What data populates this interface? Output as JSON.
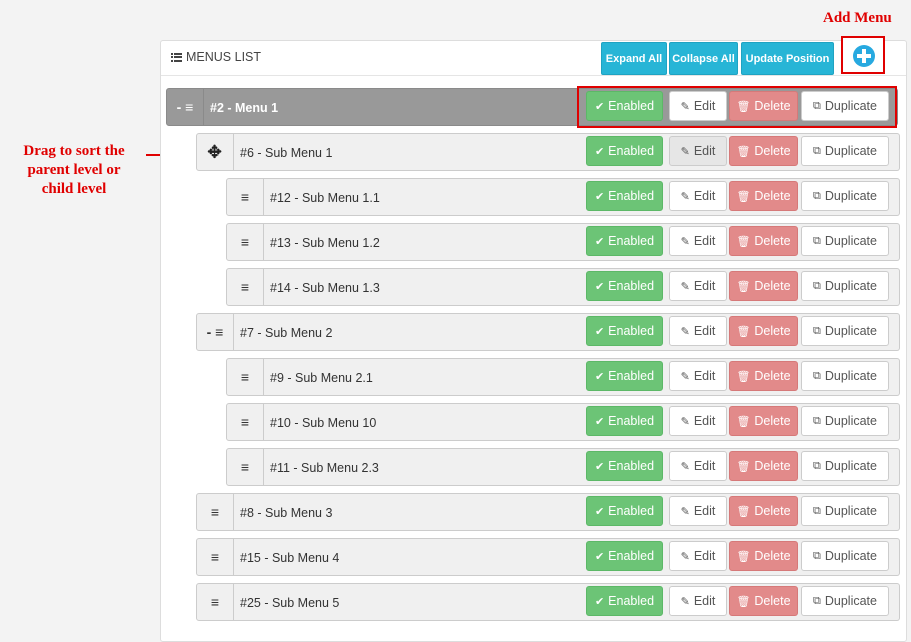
{
  "annotations": {
    "add_menu": "Add Menu",
    "drag_note": "Drag to sort the parent level or child level"
  },
  "panel": {
    "title": "MENUS LIST",
    "buttons": {
      "expand_all": "Expand All",
      "collapse_all": "Collapse All",
      "update_position": "Update Position"
    }
  },
  "row_buttons": {
    "enabled": "Enabled",
    "edit": "Edit",
    "delete": "Delete",
    "duplicate": "Duplicate"
  },
  "rows": [
    {
      "label": "#2 - Menu 1",
      "handle": "- ≡"
    },
    {
      "label": "#6 - Sub Menu 1",
      "handle": "≡"
    },
    {
      "label": "#12 - Sub Menu 1.1",
      "handle": "≡"
    },
    {
      "label": "#13 - Sub Menu 1.2",
      "handle": "≡"
    },
    {
      "label": "#14 - Sub Menu 1.3",
      "handle": "≡"
    },
    {
      "label": "#7 - Sub Menu 2",
      "handle": "- ≡"
    },
    {
      "label": "#9 - Sub Menu 2.1",
      "handle": "≡"
    },
    {
      "label": "#10 - Sub Menu 10",
      "handle": "≡"
    },
    {
      "label": "#11 - Sub Menu 2.3",
      "handle": "≡"
    },
    {
      "label": "#8 - Sub Menu 3",
      "handle": "≡"
    },
    {
      "label": "#15 - Sub Menu 4",
      "handle": "≡"
    },
    {
      "label": "#25 - Sub Menu 5",
      "handle": "≡"
    }
  ],
  "colors": {
    "enabled": "#6cc476",
    "delete": "#e28a8a",
    "accent": "#27b5d6",
    "annotation": "#e00000"
  }
}
